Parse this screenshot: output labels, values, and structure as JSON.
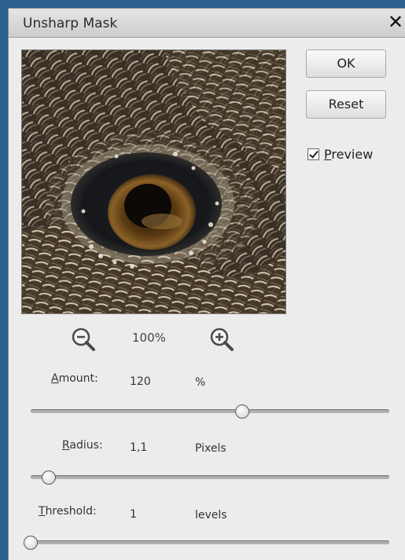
{
  "dialog": {
    "title": "Unsharp Mask",
    "close_label": "✕"
  },
  "buttons": {
    "ok_label": "OK",
    "reset_label": "Reset"
  },
  "preview_option": {
    "checked": true,
    "label_underlined": "P",
    "label_rest": "review"
  },
  "zoom": {
    "value": "100%",
    "zoom_out_icon": "zoom-out-icon",
    "zoom_in_icon": "zoom-in-icon"
  },
  "amount": {
    "label_underlined": "A",
    "label_rest": "mount:",
    "value": "120",
    "unit": "%",
    "slider_fraction": 0.59
  },
  "radius": {
    "label_underlined": "R",
    "label_rest": "adius:",
    "value": "1,1",
    "unit": "Pixels",
    "slider_fraction": 0.05
  },
  "threshold": {
    "label_underlined": "T",
    "label_rest": "hreshold:",
    "value": "1",
    "unit": "levels",
    "slider_fraction": 0.0
  },
  "colors": {
    "background": "#2a5f8e",
    "dialog": "#ececec"
  }
}
